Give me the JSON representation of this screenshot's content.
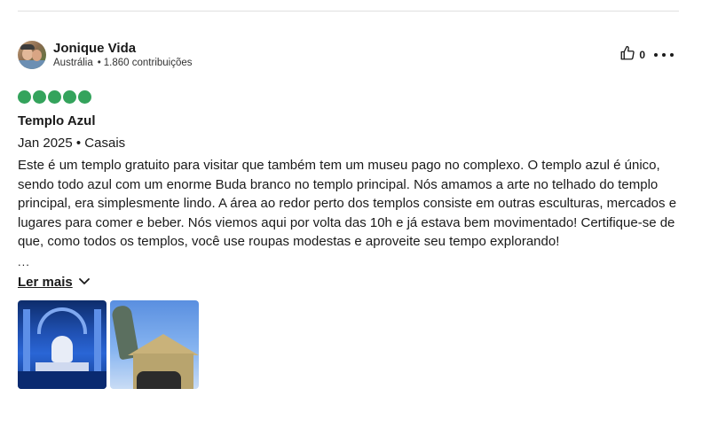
{
  "review": {
    "user": {
      "name": "Jonique Vida",
      "location": "Austrália",
      "contributions": "1.860 contribuições"
    },
    "helpful_count": "0",
    "rating": 5,
    "title": "Templo Azul",
    "date_trip": "Jan 2025 • Casais",
    "body": "Este é um templo gratuito para visitar que também tem um museu pago no complexo. O templo azul é único, sendo todo azul com um enorme Buda branco no templo principal. Nós amamos a arte no telhado do templo principal, era simplesmente lindo. A área ao redor perto dos templos consiste em outras esculturas, mercados e lugares para comer e beber. Nós viemos aqui por volta das 10h e já estava bem movimentado! Certifique-se de que, como todos os templos, você use roupas modestas e aproveite seu tempo explorando!",
    "ellipsis": "...",
    "read_more_label": "Ler mais",
    "bubble_color": "#34a35c",
    "photos": [
      "blue-temple-interior-photo",
      "blue-temple-exterior-photo"
    ]
  },
  "icons": {
    "helpful": "thumbs-up-icon",
    "more": "more-options-icon",
    "expand": "chevron-down-icon"
  }
}
